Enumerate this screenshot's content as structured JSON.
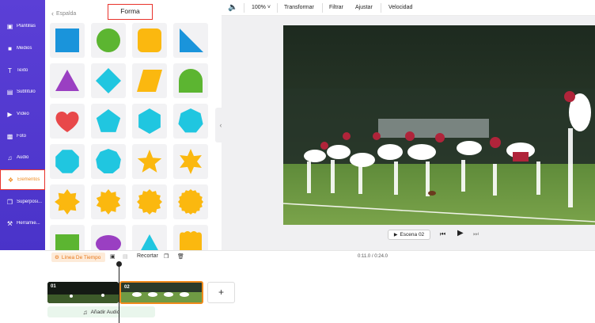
{
  "sidebar": {
    "items": [
      {
        "label": "Plantillas",
        "icon": "template-icon"
      },
      {
        "label": "Medios",
        "icon": "media-icon"
      },
      {
        "label": "Texto",
        "icon": "text-icon"
      },
      {
        "label": "Subtítulo",
        "icon": "subtitle-icon"
      },
      {
        "label": "Vídeo",
        "icon": "video-icon"
      },
      {
        "label": "Foto",
        "icon": "photo-icon"
      },
      {
        "label": "Audio",
        "icon": "audio-icon"
      },
      {
        "label": "Elementos",
        "icon": "elements-icon",
        "active": true
      },
      {
        "label": "Superposi...",
        "icon": "overlay-icon"
      },
      {
        "label": "Herramie...",
        "icon": "tools-icon"
      }
    ]
  },
  "panel": {
    "back_label": "Espalda",
    "title": "Forma",
    "shapes": [
      {
        "shape": "square",
        "color": "#1a94db"
      },
      {
        "shape": "circle",
        "color": "#5cb531"
      },
      {
        "shape": "rounded-square",
        "color": "#fbb80f"
      },
      {
        "shape": "right-triangle",
        "color": "#1a94db"
      },
      {
        "shape": "triangle",
        "color": "#9a3fc2"
      },
      {
        "shape": "diamond",
        "color": "#20c6e0"
      },
      {
        "shape": "parallelogram",
        "color": "#fbb80f"
      },
      {
        "shape": "arch",
        "color": "#5cb531"
      },
      {
        "shape": "heart",
        "color": "#e8484a"
      },
      {
        "shape": "pentagon",
        "color": "#20c6e0"
      },
      {
        "shape": "hexagon",
        "color": "#20c6e0"
      },
      {
        "shape": "heptagon",
        "color": "#20c6e0"
      },
      {
        "shape": "octagon",
        "color": "#20c6e0"
      },
      {
        "shape": "nonagon",
        "color": "#20c6e0"
      },
      {
        "shape": "star-5",
        "color": "#fbb80f"
      },
      {
        "shape": "star-6",
        "color": "#fbb80f"
      },
      {
        "shape": "burst-8",
        "color": "#fbb80f"
      },
      {
        "shape": "burst-10",
        "color": "#fbb80f"
      },
      {
        "shape": "burst-12",
        "color": "#fbb80f"
      },
      {
        "shape": "burst-16",
        "color": "#fbb80f"
      },
      {
        "shape": "rectangle",
        "color": "#5cb531"
      },
      {
        "shape": "ellipse",
        "color": "#9a3fc2"
      },
      {
        "shape": "triangle-small",
        "color": "#20c6e0"
      },
      {
        "shape": "scalloped",
        "color": "#fbb80f"
      }
    ]
  },
  "toolbar": {
    "volume_icon": "speaker-icon",
    "zoom": "100%",
    "transform": "Transformar",
    "filter": "Filtrar",
    "adjust": "Ajustar",
    "speed": "Velocidad"
  },
  "player": {
    "scene_label": "Escena  02"
  },
  "timeline": {
    "line_label": "Línea De Tiempo",
    "crop_label": "Recortar",
    "time": "0:11.0 / 0:24.0",
    "clips": [
      {
        "label": "01"
      },
      {
        "label": "02"
      }
    ],
    "add_audio": "Añadir Audio"
  },
  "colors": {
    "sidebar": "#4a33c9",
    "accent": "#f08a1c",
    "highlight_border": "#e8322b"
  }
}
